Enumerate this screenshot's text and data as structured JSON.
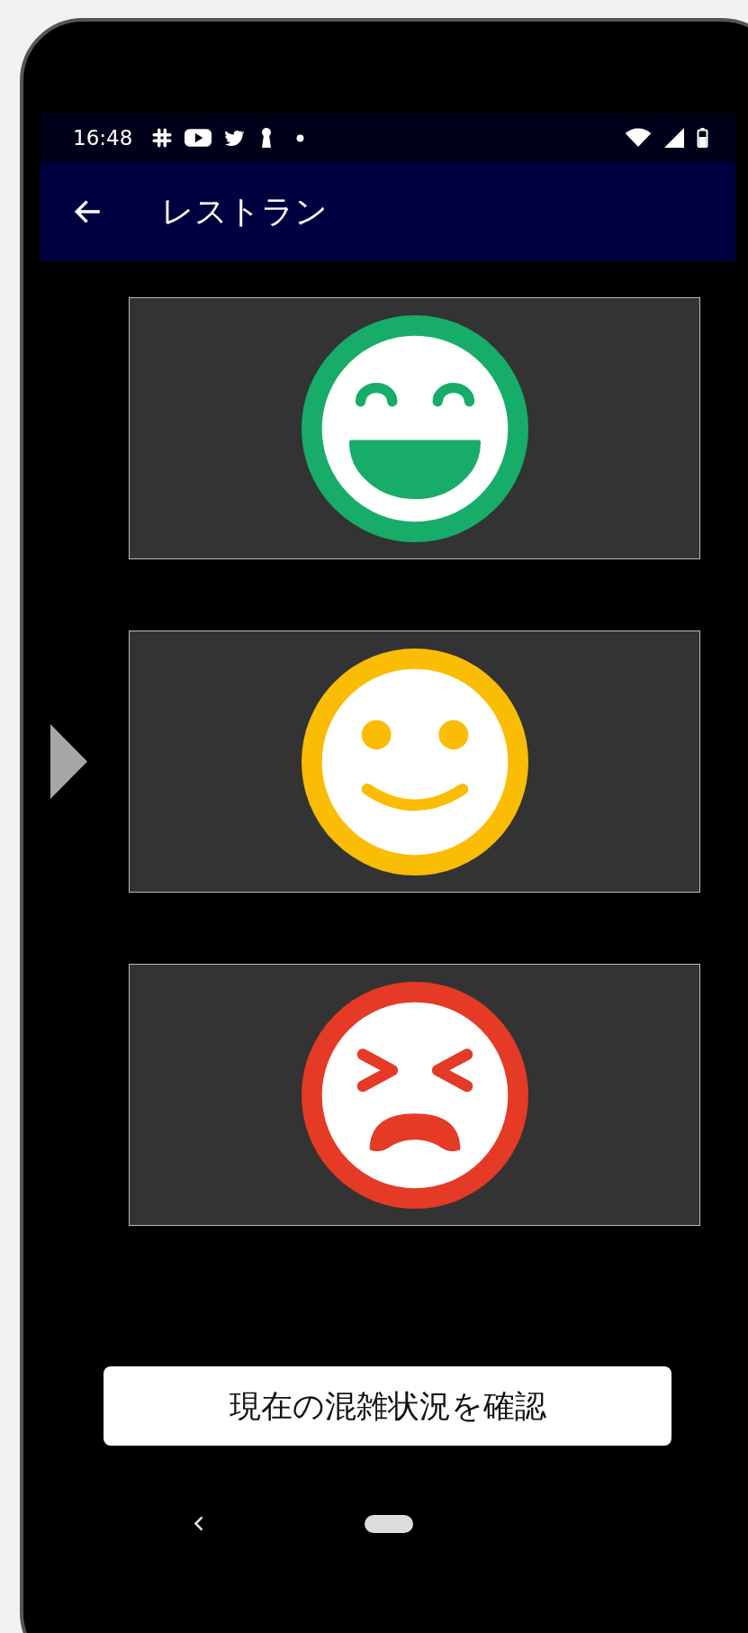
{
  "status_bar": {
    "time": "16:48"
  },
  "app_bar": {
    "title": "レストラン"
  },
  "faces": [
    {
      "kind": "laughing",
      "color": "#17ad68"
    },
    {
      "kind": "smiling",
      "color": "#fbbc04"
    },
    {
      "kind": "distressed",
      "color": "#e53a25"
    }
  ],
  "button": {
    "label": "現在の混雑状況を確認"
  }
}
